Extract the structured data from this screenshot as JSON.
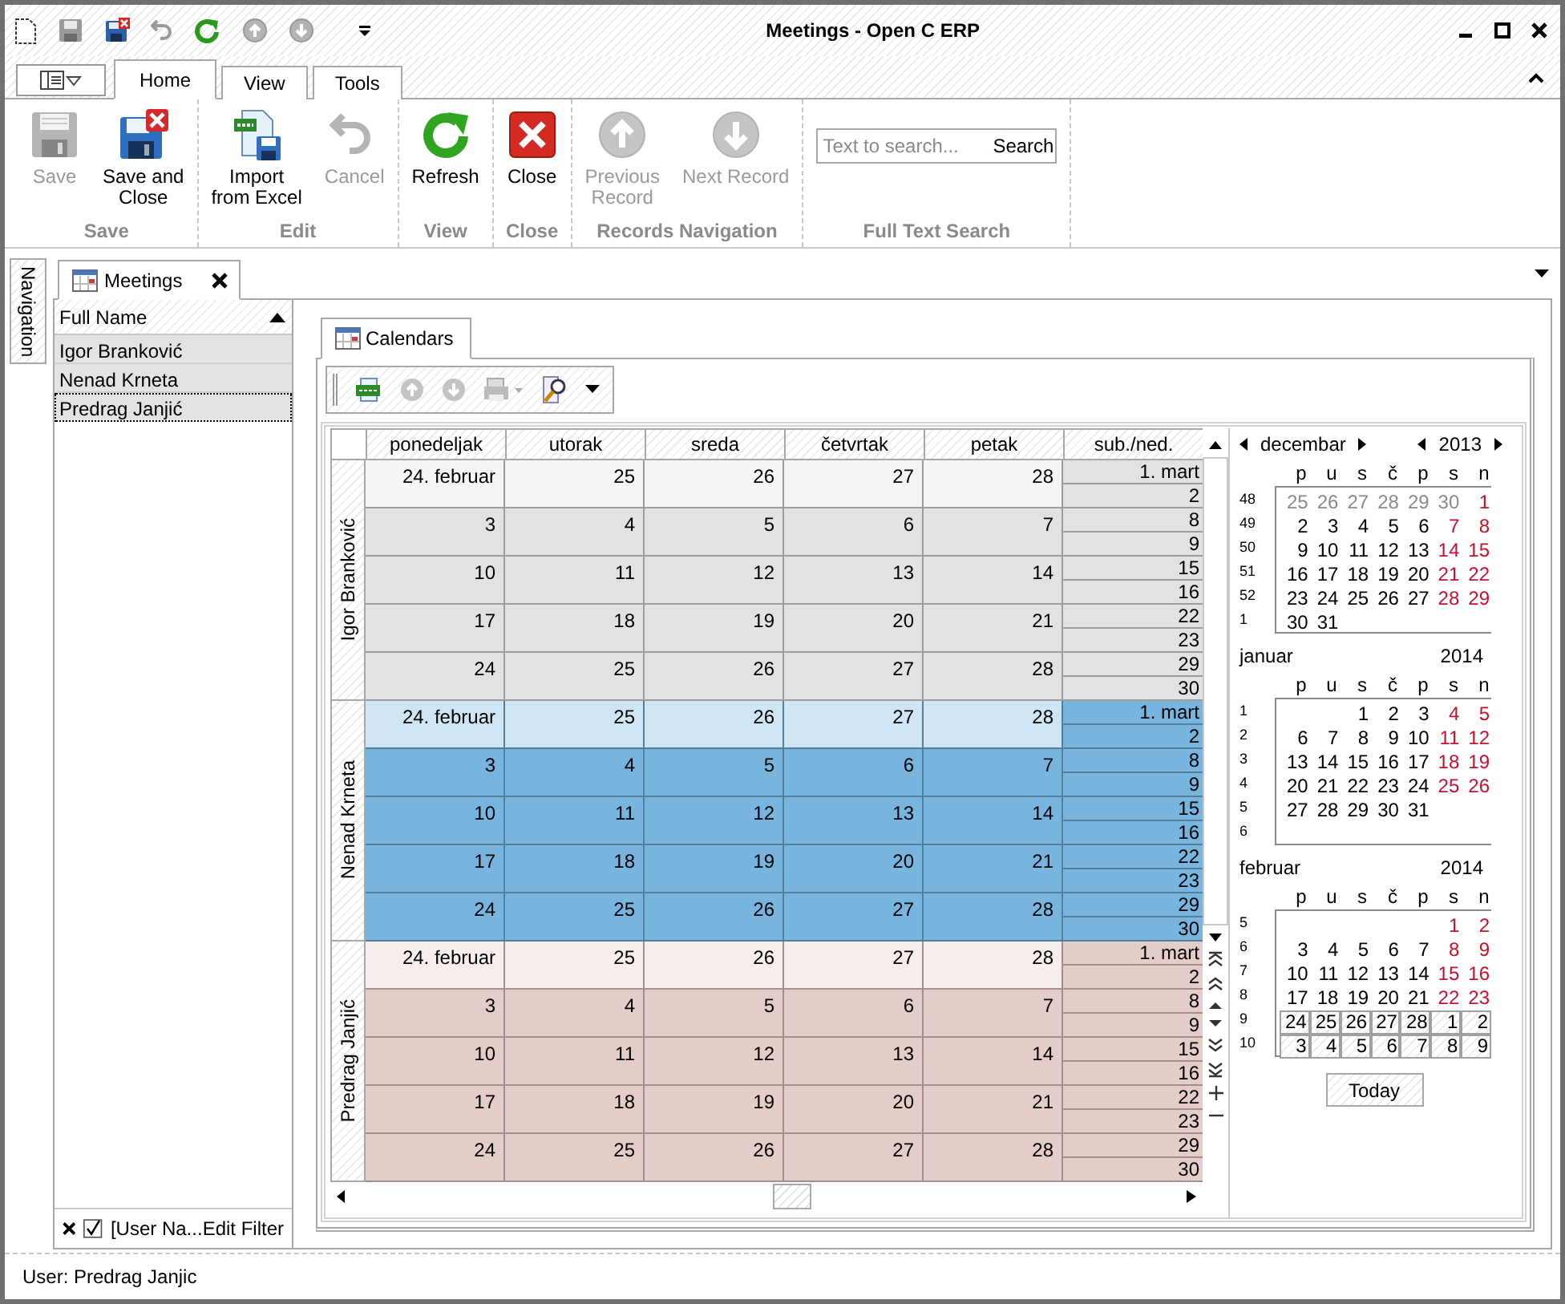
{
  "window": {
    "title": "Meetings - Open C ERP"
  },
  "ribbon_tabs": [
    {
      "label": "Home",
      "selected": true
    },
    {
      "label": "View",
      "selected": false
    },
    {
      "label": "Tools",
      "selected": false
    }
  ],
  "ribbon_groups": [
    {
      "label": "Save",
      "buttons": [
        {
          "label": "Save",
          "kind": "save",
          "disabled": true
        },
        {
          "label": "Save and\nClose",
          "kind": "save_close",
          "disabled": false
        }
      ]
    },
    {
      "label": "Edit",
      "buttons": [
        {
          "label": "Import\nfrom Excel",
          "kind": "import_excel",
          "disabled": false
        },
        {
          "label": "Cancel",
          "kind": "undo",
          "disabled": true
        }
      ]
    },
    {
      "label": "View",
      "buttons": [
        {
          "label": "Refresh",
          "kind": "refresh",
          "disabled": false
        }
      ]
    },
    {
      "label": "Close",
      "buttons": [
        {
          "label": "Close",
          "kind": "close",
          "disabled": false
        }
      ]
    },
    {
      "label": "Records Navigation",
      "buttons": [
        {
          "label": "Previous\nRecord",
          "kind": "previous",
          "disabled": true
        },
        {
          "label": "Next Record",
          "kind": "next",
          "disabled": true
        }
      ]
    }
  ],
  "search": {
    "label": "Full Text Search",
    "placeholder": "Text to search...",
    "button": "Search"
  },
  "side_tab": "Navigation",
  "document_tab": {
    "label": "Meetings"
  },
  "list": {
    "column": "Full Name",
    "rows": [
      {
        "name": "Igor Branković",
        "focused": false
      },
      {
        "name": "Nenad Krneta",
        "focused": false
      },
      {
        "name": "Predrag Janjić",
        "focused": true
      }
    ],
    "filter": {
      "checked": true,
      "text": "[User Na...",
      "link": "Edit Filter"
    }
  },
  "calendar_tab": {
    "label": "Calendars"
  },
  "scheduler": {
    "columns": [
      "ponedeljak",
      "utorak",
      "sreda",
      "četvrtak",
      "petak",
      "sub./ned."
    ],
    "resources": [
      {
        "name": "Igor Branković",
        "color": "#e2e2e2",
        "weeks": [
          {
            "highlighted": true,
            "days": [
              "24. februar",
              "25",
              "26",
              "27",
              "28"
            ],
            "weekend": [
              "1. mart",
              "2"
            ]
          },
          {
            "highlighted": false,
            "days": [
              "3",
              "4",
              "5",
              "6",
              "7"
            ],
            "weekend": [
              "8",
              "9"
            ]
          },
          {
            "highlighted": false,
            "days": [
              "10",
              "11",
              "12",
              "13",
              "14"
            ],
            "weekend": [
              "15",
              "16"
            ]
          },
          {
            "highlighted": false,
            "days": [
              "17",
              "18",
              "19",
              "20",
              "21"
            ],
            "weekend": [
              "22",
              "23"
            ]
          },
          {
            "highlighted": false,
            "days": [
              "24",
              "25",
              "26",
              "27",
              "28"
            ],
            "weekend": [
              "29",
              "30"
            ]
          }
        ]
      },
      {
        "name": "Nenad Krneta",
        "color": "#77b5de",
        "weeks": [
          {
            "highlighted": true,
            "days": [
              "24. februar",
              "25",
              "26",
              "27",
              "28"
            ],
            "weekend": [
              "1. mart",
              "2"
            ]
          },
          {
            "highlighted": false,
            "days": [
              "3",
              "4",
              "5",
              "6",
              "7"
            ],
            "weekend": [
              "8",
              "9"
            ]
          },
          {
            "highlighted": false,
            "days": [
              "10",
              "11",
              "12",
              "13",
              "14"
            ],
            "weekend": [
              "15",
              "16"
            ]
          },
          {
            "highlighted": false,
            "days": [
              "17",
              "18",
              "19",
              "20",
              "21"
            ],
            "weekend": [
              "22",
              "23"
            ]
          },
          {
            "highlighted": false,
            "days": [
              "24",
              "25",
              "26",
              "27",
              "28"
            ],
            "weekend": [
              "29",
              "30"
            ]
          }
        ]
      },
      {
        "name": "Predrag Janjić",
        "color": "#e4ccc8",
        "weeks": [
          {
            "highlighted": true,
            "days": [
              "24. februar",
              "25",
              "26",
              "27",
              "28"
            ],
            "weekend": [
              "1. mart",
              "2"
            ]
          },
          {
            "highlighted": false,
            "days": [
              "3",
              "4",
              "5",
              "6",
              "7"
            ],
            "weekend": [
              "8",
              "9"
            ]
          },
          {
            "highlighted": false,
            "days": [
              "10",
              "11",
              "12",
              "13",
              "14"
            ],
            "weekend": [
              "15",
              "16"
            ]
          },
          {
            "highlighted": false,
            "days": [
              "17",
              "18",
              "19",
              "20",
              "21"
            ],
            "weekend": [
              "22",
              "23"
            ]
          },
          {
            "highlighted": false,
            "days": [
              "24",
              "25",
              "26",
              "27",
              "28"
            ],
            "weekend": [
              "29",
              "30"
            ]
          }
        ]
      }
    ]
  },
  "date_navigator": {
    "months": [
      {
        "month": "decembar",
        "year": "2013",
        "navigation": true,
        "weekdays": [
          "p",
          "u",
          "s",
          "č",
          "p",
          "s",
          "n"
        ],
        "weeks": [
          {
            "number": "48",
            "selected": false,
            "days": [
              {
                "text": "25",
                "kind": "other"
              },
              {
                "text": "26",
                "kind": "other"
              },
              {
                "text": "27",
                "kind": "other"
              },
              {
                "text": "28",
                "kind": "other"
              },
              {
                "text": "29",
                "kind": "other"
              },
              {
                "text": "30",
                "kind": "other"
              },
              {
                "text": "1",
                "kind": "weekend"
              }
            ]
          },
          {
            "number": "49",
            "selected": false,
            "days": [
              {
                "text": "2",
                "kind": "weekday"
              },
              {
                "text": "3",
                "kind": "weekday"
              },
              {
                "text": "4",
                "kind": "weekday"
              },
              {
                "text": "5",
                "kind": "weekday"
              },
              {
                "text": "6",
                "kind": "weekday"
              },
              {
                "text": "7",
                "kind": "weekend"
              },
              {
                "text": "8",
                "kind": "weekend"
              }
            ]
          },
          {
            "number": "50",
            "selected": false,
            "days": [
              {
                "text": "9",
                "kind": "weekday"
              },
              {
                "text": "10",
                "kind": "weekday"
              },
              {
                "text": "11",
                "kind": "weekday"
              },
              {
                "text": "12",
                "kind": "weekday"
              },
              {
                "text": "13",
                "kind": "weekday"
              },
              {
                "text": "14",
                "kind": "weekend"
              },
              {
                "text": "15",
                "kind": "weekend"
              }
            ]
          },
          {
            "number": "51",
            "selected": false,
            "days": [
              {
                "text": "16",
                "kind": "weekday"
              },
              {
                "text": "17",
                "kind": "weekday"
              },
              {
                "text": "18",
                "kind": "weekday"
              },
              {
                "text": "19",
                "kind": "weekday"
              },
              {
                "text": "20",
                "kind": "weekday"
              },
              {
                "text": "21",
                "kind": "weekend"
              },
              {
                "text": "22",
                "kind": "weekend"
              }
            ]
          },
          {
            "number": "52",
            "selected": false,
            "days": [
              {
                "text": "23",
                "kind": "weekday"
              },
              {
                "text": "24",
                "kind": "weekday"
              },
              {
                "text": "25",
                "kind": "weekday"
              },
              {
                "text": "26",
                "kind": "weekday"
              },
              {
                "text": "27",
                "kind": "weekday"
              },
              {
                "text": "28",
                "kind": "weekend"
              },
              {
                "text": "29",
                "kind": "weekend"
              }
            ]
          },
          {
            "number": "1",
            "selected": false,
            "days": [
              {
                "text": "30",
                "kind": "weekday"
              },
              {
                "text": "31",
                "kind": "weekday"
              },
              {
                "kind": "blank"
              },
              {
                "kind": "blank"
              },
              {
                "kind": "blank"
              },
              {
                "kind": "blank"
              },
              {
                "kind": "blank"
              }
            ]
          }
        ]
      },
      {
        "month": "januar",
        "year": "2014",
        "navigation": false,
        "weekdays": [
          "p",
          "u",
          "s",
          "č",
          "p",
          "s",
          "n"
        ],
        "weeks": [
          {
            "number": "1",
            "selected": false,
            "days": [
              {
                "kind": "blank"
              },
              {
                "kind": "blank"
              },
              {
                "text": "1",
                "kind": "weekday"
              },
              {
                "text": "2",
                "kind": "weekday"
              },
              {
                "text": "3",
                "kind": "weekday"
              },
              {
                "text": "4",
                "kind": "weekend"
              },
              {
                "text": "5",
                "kind": "weekend"
              }
            ]
          },
          {
            "number": "2",
            "selected": false,
            "days": [
              {
                "text": "6",
                "kind": "weekday"
              },
              {
                "text": "7",
                "kind": "weekday"
              },
              {
                "text": "8",
                "kind": "weekday"
              },
              {
                "text": "9",
                "kind": "weekday"
              },
              {
                "text": "10",
                "kind": "weekday"
              },
              {
                "text": "11",
                "kind": "weekend"
              },
              {
                "text": "12",
                "kind": "weekend"
              }
            ]
          },
          {
            "number": "3",
            "selected": false,
            "days": [
              {
                "text": "13",
                "kind": "weekday"
              },
              {
                "text": "14",
                "kind": "weekday"
              },
              {
                "text": "15",
                "kind": "weekday"
              },
              {
                "text": "16",
                "kind": "weekday"
              },
              {
                "text": "17",
                "kind": "weekday"
              },
              {
                "text": "18",
                "kind": "weekend"
              },
              {
                "text": "19",
                "kind": "weekend"
              }
            ]
          },
          {
            "number": "4",
            "selected": false,
            "days": [
              {
                "text": "20",
                "kind": "weekday"
              },
              {
                "text": "21",
                "kind": "weekday"
              },
              {
                "text": "22",
                "kind": "weekday"
              },
              {
                "text": "23",
                "kind": "weekday"
              },
              {
                "text": "24",
                "kind": "weekday"
              },
              {
                "text": "25",
                "kind": "weekend"
              },
              {
                "text": "26",
                "kind": "weekend"
              }
            ]
          },
          {
            "number": "5",
            "selected": false,
            "days": [
              {
                "text": "27",
                "kind": "weekday"
              },
              {
                "text": "28",
                "kind": "weekday"
              },
              {
                "text": "29",
                "kind": "weekday"
              },
              {
                "text": "30",
                "kind": "weekday"
              },
              {
                "text": "31",
                "kind": "weekday"
              },
              {
                "kind": "blank"
              },
              {
                "kind": "blank"
              }
            ]
          },
          {
            "number": "6",
            "selected": false
          }
        ]
      },
      {
        "month": "februar",
        "year": "2014",
        "navigation": false,
        "weekdays": [
          "p",
          "u",
          "s",
          "č",
          "p",
          "s",
          "n"
        ],
        "weeks": [
          {
            "number": "5",
            "selected": false,
            "days": [
              {
                "kind": "blank"
              },
              {
                "kind": "blank"
              },
              {
                "kind": "blank"
              },
              {
                "kind": "blank"
              },
              {
                "kind": "blank"
              },
              {
                "text": "1",
                "kind": "weekend"
              },
              {
                "text": "2",
                "kind": "weekend"
              }
            ]
          },
          {
            "number": "6",
            "selected": false,
            "days": [
              {
                "text": "3",
                "kind": "weekday"
              },
              {
                "text": "4",
                "kind": "weekday"
              },
              {
                "text": "5",
                "kind": "weekday"
              },
              {
                "text": "6",
                "kind": "weekday"
              },
              {
                "text": "7",
                "kind": "weekday"
              },
              {
                "text": "8",
                "kind": "weekend"
              },
              {
                "text": "9",
                "kind": "weekend"
              }
            ]
          },
          {
            "number": "7",
            "selected": false,
            "days": [
              {
                "text": "10",
                "kind": "weekday"
              },
              {
                "text": "11",
                "kind": "weekday"
              },
              {
                "text": "12",
                "kind": "weekday"
              },
              {
                "text": "13",
                "kind": "weekday"
              },
              {
                "text": "14",
                "kind": "weekday"
              },
              {
                "text": "15",
                "kind": "weekend"
              },
              {
                "text": "16",
                "kind": "weekend"
              }
            ]
          },
          {
            "number": "8",
            "selected": false,
            "days": [
              {
                "text": "17",
                "kind": "weekday"
              },
              {
                "text": "18",
                "kind": "weekday"
              },
              {
                "text": "19",
                "kind": "weekday"
              },
              {
                "text": "20",
                "kind": "weekday"
              },
              {
                "text": "21",
                "kind": "weekday"
              },
              {
                "text": "22",
                "kind": "weekend"
              },
              {
                "text": "23",
                "kind": "weekend"
              }
            ]
          },
          {
            "number": "9",
            "selected": true,
            "days": [
              {
                "text": "24",
                "kind": "weekday"
              },
              {
                "text": "25",
                "kind": "weekday"
              },
              {
                "text": "26",
                "kind": "weekday"
              },
              {
                "text": "27",
                "kind": "weekday"
              },
              {
                "text": "28",
                "kind": "weekday"
              },
              {
                "text": "1",
                "kind": "weekday"
              },
              {
                "text": "2",
                "kind": "weekday"
              }
            ]
          },
          {
            "number": "10",
            "selected": true,
            "days": [
              {
                "text": "3",
                "kind": "weekday"
              },
              {
                "text": "4",
                "kind": "weekday"
              },
              {
                "text": "5",
                "kind": "weekday"
              },
              {
                "text": "6",
                "kind": "weekday"
              },
              {
                "text": "7",
                "kind": "weekday"
              },
              {
                "text": "8",
                "kind": "weekday"
              },
              {
                "text": "9",
                "kind": "weekday"
              }
            ]
          }
        ]
      }
    ],
    "button": "Today"
  },
  "status_bar": "User: Predrag Janjic"
}
